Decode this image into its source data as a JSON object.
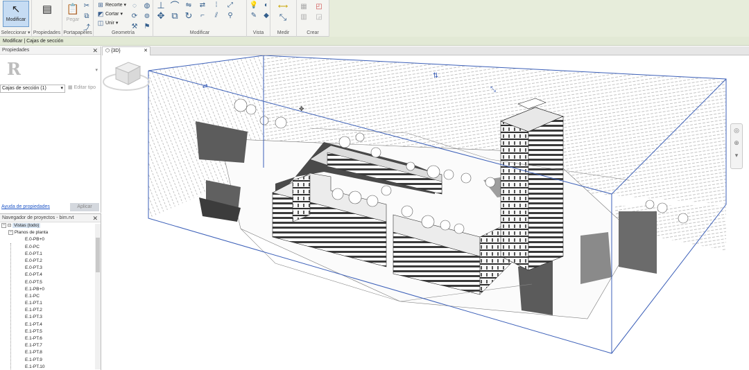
{
  "ribbon": {
    "modify_button": "Modificar",
    "select_menu": "Seleccionar",
    "properties_button": "Propiedades",
    "paste_button": "Pegar",
    "clipboard_panel": "Portapapeles",
    "geometry_panel": "Geometría",
    "modify_panel": "Modificar",
    "view_panel": "Vista",
    "measure_panel": "Medir",
    "create_panel": "Crear",
    "cope_label": "Recorte",
    "cut_label": "Cortar",
    "join_label": "Unir"
  },
  "context_bar": {
    "text": "Modificar | Cajas de sección"
  },
  "properties": {
    "title": "Propiedades",
    "type_selector": "Cajas de sección (1)",
    "edit_type": "Editar tipo",
    "help_link": "Ayuda de propiedades",
    "apply_button": "Aplicar"
  },
  "project_browser": {
    "title": "Navegador de proyectos - bim.rvt",
    "root": "Vistas (todo)",
    "group": "Planos de planta",
    "items": [
      "E.0-PB+0",
      "E.0-PC",
      "E.0-PT.1",
      "E.0-PT.2",
      "E.0-PT.3",
      "E.0-PT.4",
      "E.0-PT.5",
      "E.1-PB+0",
      "E.1-PC",
      "E.1-PT.1",
      "E.1-PT.2",
      "E.1-PT.3",
      "E.1-PT.4",
      "E.1-PT.5",
      "E.1-PT.6",
      "E.1-PT.7",
      "E.1-PT.8",
      "E.1-PT.9",
      "E.1-PT.10"
    ]
  },
  "view_tab": {
    "label": "{3D}"
  },
  "colors": {
    "section_box": "#3b5fb8",
    "ribbon_active": "#c6dcf3",
    "context_bar": "#e2e9d5",
    "link": "#1f56c7"
  }
}
